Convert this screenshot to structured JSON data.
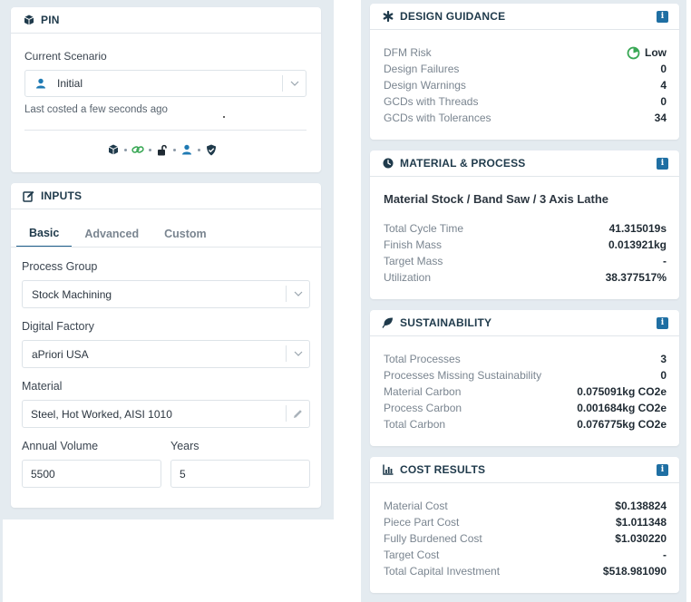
{
  "pin": {
    "title": "PIN",
    "current_scenario_label": "Current Scenario",
    "scenario_value": "Initial",
    "last_costed": "Last costed a few seconds ago"
  },
  "inputs": {
    "title": "INPUTS",
    "tabs": [
      {
        "label": "Basic",
        "active": true
      },
      {
        "label": "Advanced",
        "active": false
      },
      {
        "label": "Custom",
        "active": false
      }
    ],
    "process_group_label": "Process Group",
    "process_group_value": "Stock Machining",
    "digital_factory_label": "Digital Factory",
    "digital_factory_value": "aPriori USA",
    "material_label": "Material",
    "material_value": "Steel, Hot Worked, AISI 1010",
    "annual_volume_label": "Annual Volume",
    "annual_volume_value": "5500",
    "years_label": "Years",
    "years_value": "5"
  },
  "design_guidance": {
    "title": "DESIGN GUIDANCE",
    "info": "i",
    "rows": [
      {
        "label": "DFM Risk",
        "value": "Low"
      },
      {
        "label": "Design Failures",
        "value": "0"
      },
      {
        "label": "Design Warnings",
        "value": "4"
      },
      {
        "label": "GCDs with Threads",
        "value": "0"
      },
      {
        "label": "GCDs with Tolerances",
        "value": "34"
      }
    ]
  },
  "material_process": {
    "title": "MATERIAL & PROCESS",
    "info": "i",
    "routing": "Material Stock / Band Saw / 3 Axis Lathe",
    "rows": [
      {
        "label": "Total Cycle Time",
        "value": "41.315019s"
      },
      {
        "label": "Finish Mass",
        "value": "0.013921kg"
      },
      {
        "label": "Target Mass",
        "value": "-"
      },
      {
        "label": "Utilization",
        "value": "38.377517%"
      }
    ]
  },
  "sustainability": {
    "title": "SUSTAINABILITY",
    "info": "i",
    "rows": [
      {
        "label": "Total Processes",
        "value": "3"
      },
      {
        "label": "Processes Missing Sustainability",
        "value": "0"
      },
      {
        "label": "Material Carbon",
        "value": "0.075091kg CO2e"
      },
      {
        "label": "Process Carbon",
        "value": "0.001684kg CO2e"
      },
      {
        "label": "Total Carbon",
        "value": "0.076775kg CO2e"
      }
    ]
  },
  "cost_results": {
    "title": "COST RESULTS",
    "info": "i",
    "rows": [
      {
        "label": "Material Cost",
        "value": "$0.138824"
      },
      {
        "label": "Piece Part Cost",
        "value": "$1.011348"
      },
      {
        "label": "Fully Burdened Cost",
        "value": "$1.030220"
      },
      {
        "label": "Target Cost",
        "value": "-"
      },
      {
        "label": "Total Capital Investment",
        "value": "$518.981090"
      }
    ]
  },
  "colors": {
    "accent": "#1f5f8b",
    "heading": "#1f3a4b",
    "risk_low": "#3aa856",
    "background": "#e4ebf0"
  }
}
